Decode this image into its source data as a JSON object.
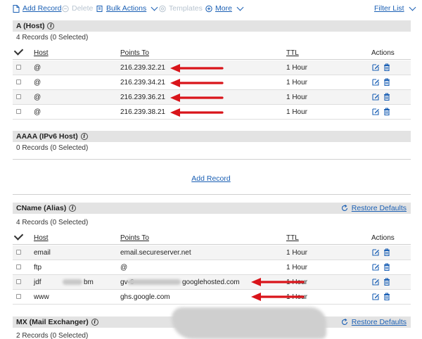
{
  "toolbar": {
    "add_record": "Add Record",
    "delete": "Delete",
    "bulk_actions": "Bulk Actions",
    "templates": "Templates",
    "more": "More",
    "filter_list": "Filter List"
  },
  "columns": {
    "host": "Host",
    "points_to": "Points To",
    "ttl": "TTL",
    "actions": "Actions"
  },
  "a_section": {
    "title": "A (Host)",
    "count": "4 Records (0 Selected)",
    "rows": [
      {
        "host": "@",
        "points_to": "216.239.32.21",
        "ttl": "1 Hour"
      },
      {
        "host": "@",
        "points_to": "216.239.34.21",
        "ttl": "1 Hour"
      },
      {
        "host": "@",
        "points_to": "216.239.36.21",
        "ttl": "1 Hour"
      },
      {
        "host": "@",
        "points_to": "216.239.38.21",
        "ttl": "1 Hour"
      }
    ]
  },
  "aaaa_section": {
    "title": "AAAA (IPv6 Host)",
    "count": "0 Records (0 Selected)",
    "add_record": "Add Record"
  },
  "cname_section": {
    "title": "CName (Alias)",
    "restore": "Restore Defaults",
    "count": "4 Records (0 Selected)",
    "rows": [
      {
        "host": "email",
        "points_to": "email.secureserver.net",
        "ttl": "1 Hour"
      },
      {
        "host": "ftp",
        "points_to": "@",
        "ttl": "1 Hour"
      },
      {
        "host": "jdf",
        "host_end": "bm",
        "points_to": "gv-6",
        "points_to_end": "googlehosted.com",
        "ttl": "1 Hour"
      },
      {
        "host": "www",
        "points_to": "ghs.google.com",
        "ttl": "1 Hour"
      }
    ]
  },
  "mx_section": {
    "title": "MX (Mail Exchanger)",
    "restore": "Restore Defaults",
    "count": "2 Records (0 Selected)"
  },
  "colors": {
    "link": "#1a5fb4",
    "arrow": "#d9141a",
    "section_bg": "#e3e3e3"
  }
}
